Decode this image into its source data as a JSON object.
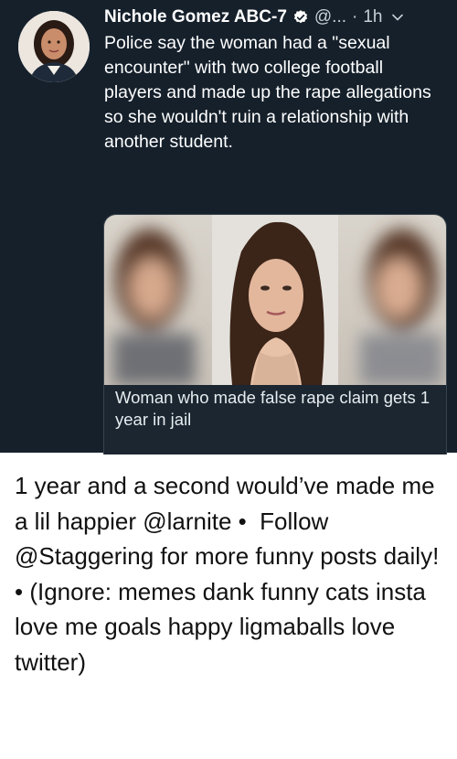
{
  "tweet": {
    "display_name": "Nichole Gomez ABC-7",
    "handle": "@...",
    "separator": "·",
    "time": "1h",
    "text": "Police say the woman had a \"sexual encounter\" with two college football players and made up the rape allegations so she wouldn't ruin a relationship with another student.",
    "verified_icon": "verified-badge-icon",
    "menu_icon": "chevron-down-icon",
    "card": {
      "caption": "Woman who made false rape claim gets 1 year in jail"
    }
  },
  "post_caption": "1 year and a second would’ve made me a lil happier @larnite • ​ Follow @Staggering for more funny posts daily! • (Ignore: memes dank funny cats insta love me goals happy ligmaballs love twitter)",
  "colors": {
    "tweet_background": "#15202b",
    "page_background": "#ffffff",
    "verified": "#ffffff"
  }
}
